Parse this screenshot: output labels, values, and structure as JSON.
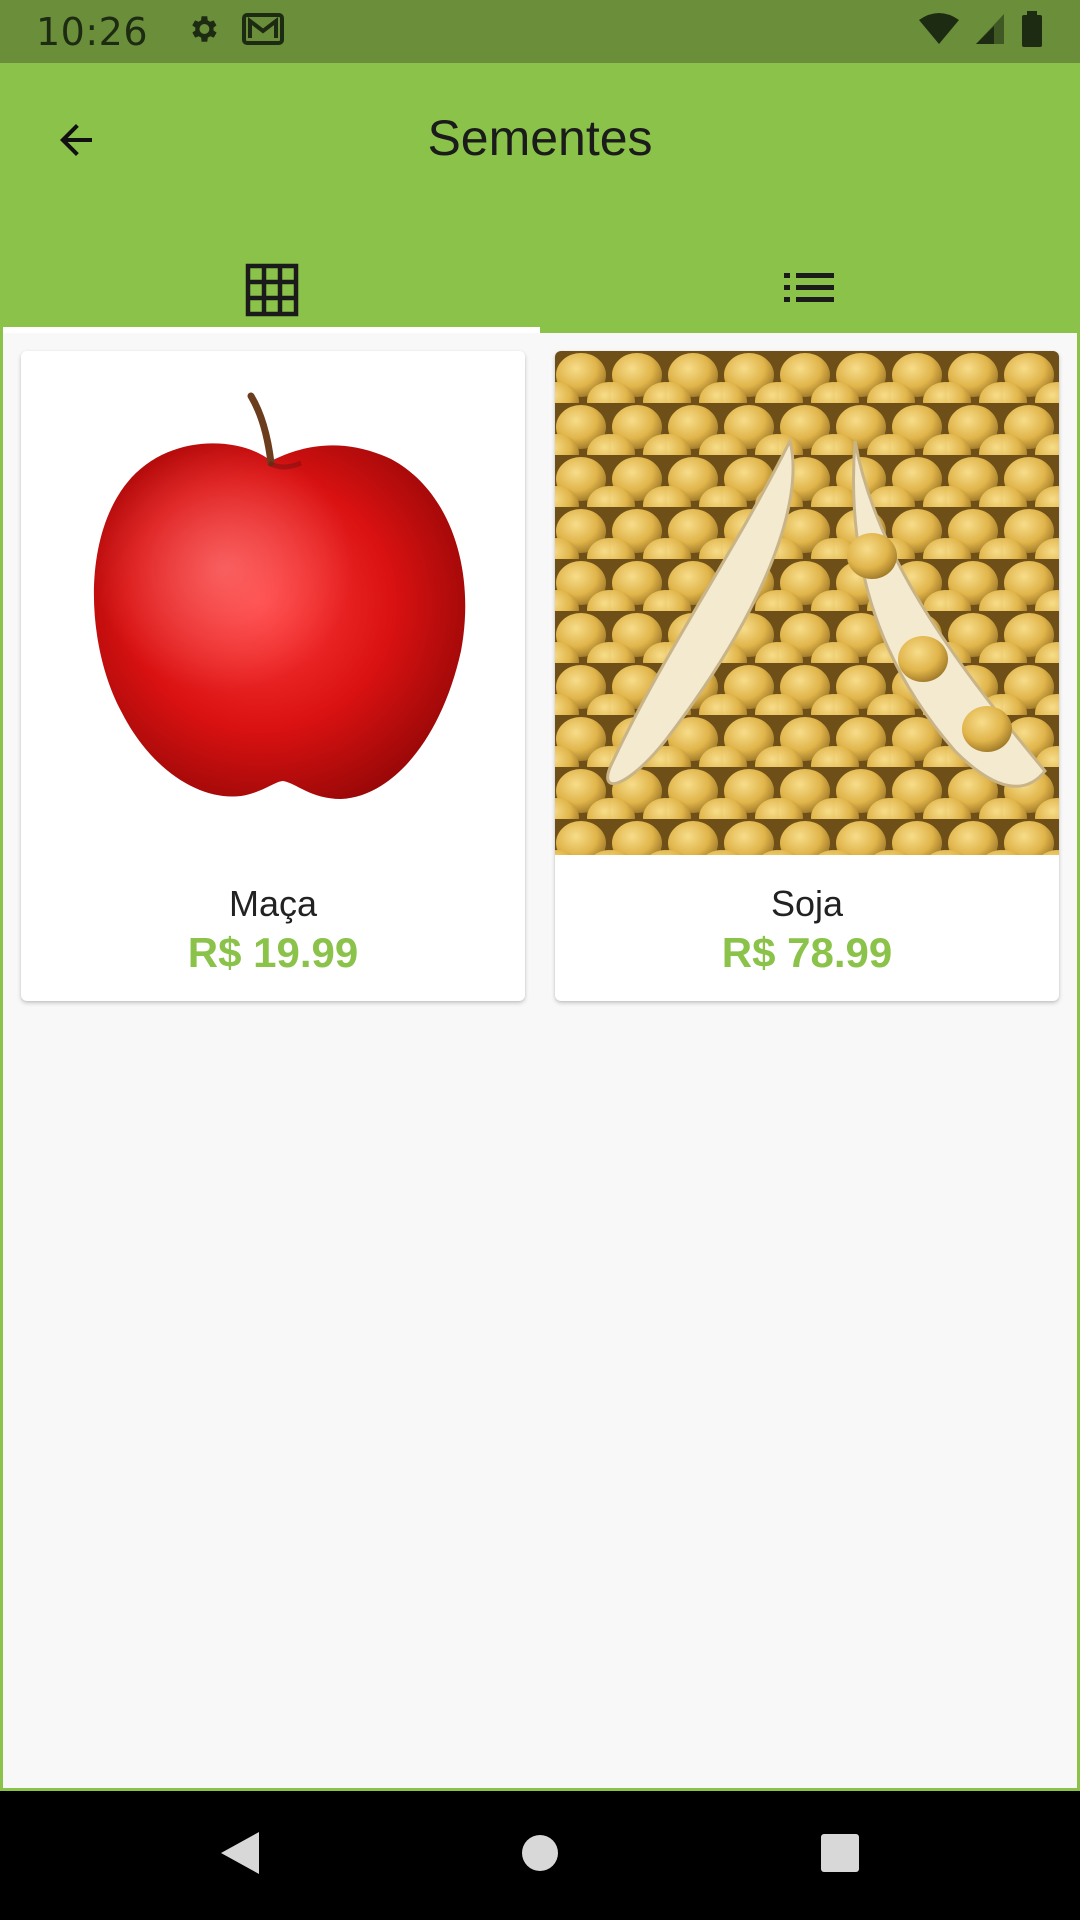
{
  "status_bar": {
    "time": "10:26",
    "left_icons": [
      "gear-icon",
      "gmail-icon"
    ],
    "right_icons": [
      "wifi-icon",
      "signal-icon",
      "battery-icon"
    ]
  },
  "header": {
    "title": "Sementes",
    "back_icon": "arrow-back-icon",
    "background_color": "#8bc34a"
  },
  "tabs": [
    {
      "icon": "grid-icon",
      "active": true
    },
    {
      "icon": "list-icon",
      "active": false
    }
  ],
  "products": [
    {
      "name": "Maça",
      "price": "R$ 19.99",
      "image": "red-apple"
    },
    {
      "name": "Soja",
      "price": "R$ 78.99",
      "image": "soybeans-pods"
    }
  ],
  "colors": {
    "accent": "#8bc34a",
    "price": "#8bc34a",
    "status_bar": "#6a8e3a"
  },
  "nav_bar": {
    "icons": [
      "back-triangle-icon",
      "home-circle-icon",
      "recents-square-icon"
    ]
  }
}
